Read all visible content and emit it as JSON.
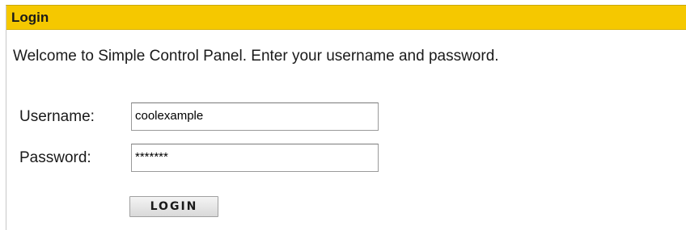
{
  "panel": {
    "title": "Login",
    "welcome_text": "Welcome to Simple Control Panel. Enter your username and password."
  },
  "form": {
    "username_label": "Username:",
    "username_value": "coolexample",
    "password_label": "Password:",
    "password_value": "*******",
    "login_button_label": "LOGIN"
  },
  "colors": {
    "header_background": "#f5c800",
    "page_background": "#ffffff"
  }
}
